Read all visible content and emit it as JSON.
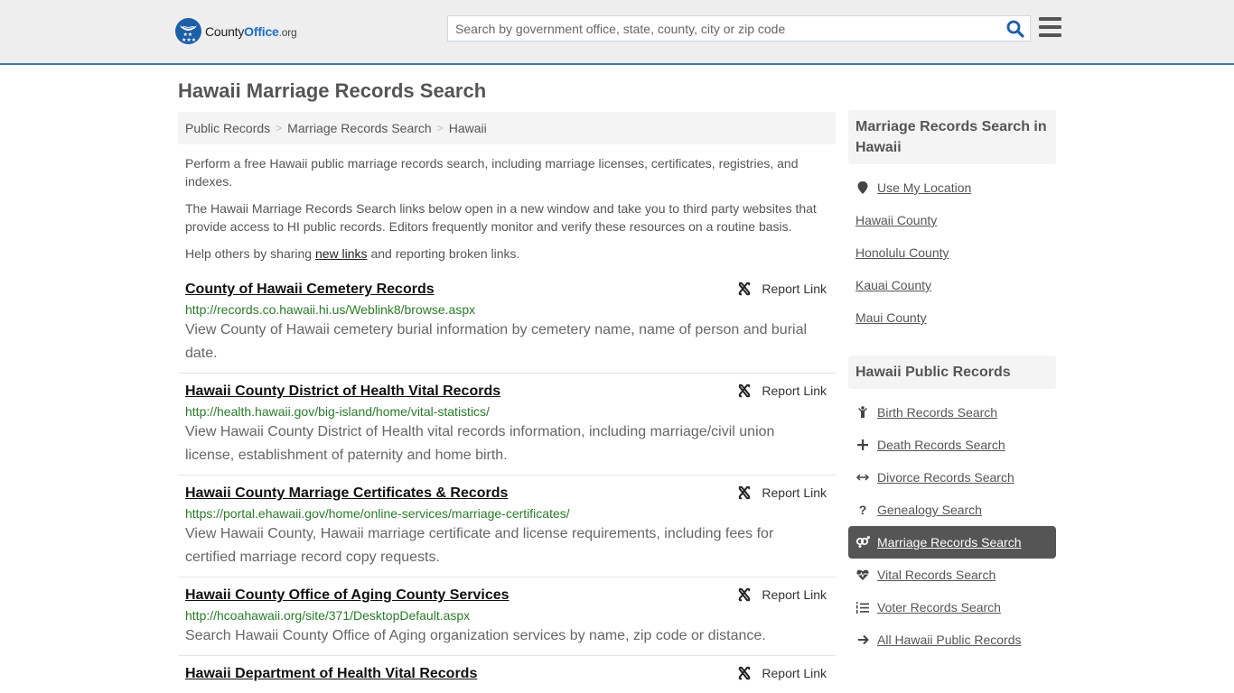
{
  "header": {
    "logo": {
      "name_part1": "County",
      "name_part2": "Office",
      "name_part3": ".org"
    },
    "search": {
      "placeholder": "Search by government office, state, county, city or zip code",
      "value": ""
    },
    "colors": {
      "brand_blue": "#1d5ea8",
      "header_border": "#3c78a8"
    }
  },
  "page": {
    "title": "Hawaii Marriage Records Search",
    "breadcrumb": [
      {
        "label": "Public Records"
      },
      {
        "label": "Marriage Records Search"
      },
      {
        "label": "Hawaii"
      }
    ],
    "intro": {
      "p1": "Perform a free Hawaii public marriage records search, including marriage licenses, certificates, registries, and indexes.",
      "p2": "The Hawaii Marriage Records Search links below open in a new window and take you to third party websites that provide access to HI public records. Editors frequently monitor and verify these resources on a routine basis.",
      "p3_before": "Help others by sharing ",
      "p3_link": "new links",
      "p3_after": " and reporting broken links."
    },
    "report_label": "Report Link",
    "records": [
      {
        "title": "County of Hawaii Cemetery Records",
        "url": "http://records.co.hawaii.hi.us/Weblink8/browse.aspx",
        "description": "View County of Hawaii cemetery burial information by cemetery name, name of person and burial date."
      },
      {
        "title": "Hawaii County District of Health Vital Records",
        "url": "http://health.hawaii.gov/big-island/home/vital-statistics/",
        "description": "View Hawaii County District of Health vital records information, including marriage/civil union license, establishment of paternity and home birth."
      },
      {
        "title": "Hawaii County Marriage Certificates & Records",
        "url": "https://portal.ehawaii.gov/home/online-services/marriage-certificates/",
        "description": "View Hawaii County, Hawaii marriage certificate and license requirements, including fees for certified marriage record copy requests."
      },
      {
        "title": "Hawaii County Office of Aging County Services",
        "url": "http://hcoahawaii.org/site/371/DesktopDefault.aspx",
        "description": "Search Hawaii County Office of Aging organization services by name, zip code or distance."
      },
      {
        "title": "Hawaii Department of Health Vital Records",
        "url": "",
        "description": ""
      }
    ]
  },
  "sidebar": {
    "section1": {
      "heading": "Marriage Records Search in Hawaii",
      "items": [
        {
          "label": "Use My Location",
          "icon": "map-marker-icon"
        },
        {
          "label": "Hawaii County"
        },
        {
          "label": "Honolulu County"
        },
        {
          "label": "Kauai County"
        },
        {
          "label": "Maui County"
        }
      ]
    },
    "section2": {
      "heading": "Hawaii Public Records",
      "items": [
        {
          "label": "Birth Records Search",
          "icon": "child-icon"
        },
        {
          "label": "Death Records Search",
          "icon": "plus-icon"
        },
        {
          "label": "Divorce Records Search",
          "icon": "arrows-h-icon"
        },
        {
          "label": "Genealogy Search",
          "icon": "question-icon"
        },
        {
          "label": "Marriage Records Search",
          "icon": "venus-mars-icon",
          "active": true
        },
        {
          "label": "Vital Records Search",
          "icon": "heartbeat-icon"
        },
        {
          "label": "Voter Records Search",
          "icon": "list-ol-icon"
        },
        {
          "label": "All Hawaii Public Records",
          "icon": "arrow-right-icon"
        }
      ]
    }
  }
}
